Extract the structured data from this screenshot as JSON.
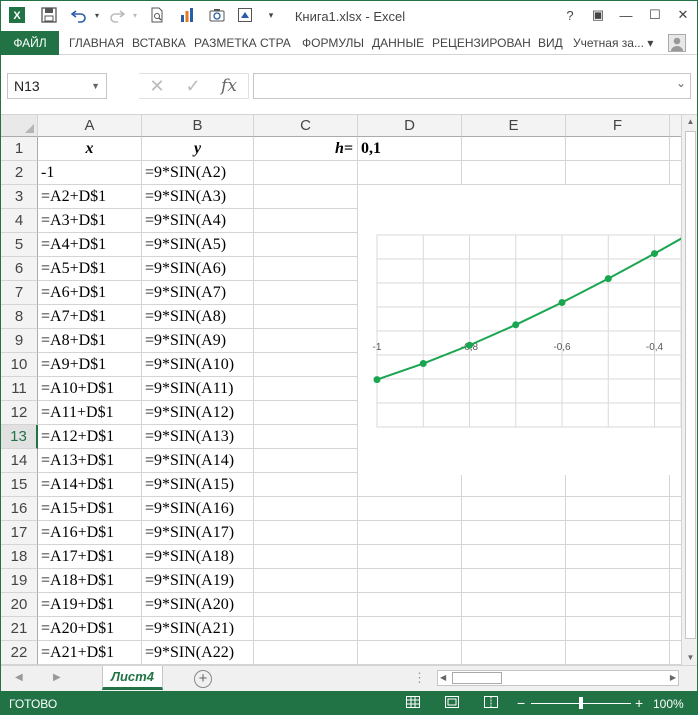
{
  "titlebar": {
    "title": "Книга1.xlsx - Excel",
    "app_icon": "excel-logo",
    "qat_icons": [
      "save-icon",
      "undo-icon",
      "redo-icon",
      "print-preview-icon",
      "chart-icon",
      "camera-icon",
      "screenshot-icon",
      "customize-qat-icon"
    ],
    "help": "?",
    "ribbon_display": "▣",
    "minimize": "—",
    "maximize": "☐",
    "close": "✕"
  },
  "ribbon": {
    "file_tab": "ФАЙЛ",
    "tabs": [
      "ГЛАВНАЯ",
      "ВСТАВКА",
      "РАЗМЕТКА СТРА",
      "ФОРМУЛЫ",
      "ДАННЫЕ",
      "РЕЦЕНЗИРОВАН",
      "ВИД"
    ],
    "account": "Учетная за...",
    "account_arrow": "▾"
  },
  "formula_bar": {
    "name_box": "N13",
    "cancel_glyph": "✕",
    "enter_glyph": "✓",
    "fx_label": "fx",
    "formula": ""
  },
  "grid": {
    "column_headers": [
      "A",
      "B",
      "C",
      "D",
      "E",
      "F"
    ],
    "row_headers": [
      "1",
      "2",
      "3",
      "4",
      "5",
      "6",
      "7",
      "8",
      "9",
      "10",
      "11",
      "12",
      "13",
      "14",
      "15",
      "16",
      "17",
      "18",
      "19",
      "20",
      "21",
      "22"
    ],
    "selected_row": "13",
    "header_row": {
      "A": "x",
      "B": "y",
      "C": "h=",
      "D": "0,1"
    },
    "col_a": [
      "-1",
      "=A2+D$1",
      "=A3+D$1",
      "=A4+D$1",
      "=A5+D$1",
      "=A6+D$1",
      "=A7+D$1",
      "=A8+D$1",
      "=A9+D$1",
      "=A10+D$1",
      "=A11+D$1",
      "=A12+D$1",
      "=A13+D$1",
      "=A14+D$1",
      "=A15+D$1",
      "=A16+D$1",
      "=A17+D$1",
      "=A18+D$1",
      "=A19+D$1",
      "=A20+D$1",
      "=A21+D$1"
    ],
    "col_b": [
      "=9*SIN(A2)",
      "=9*SIN(A3)",
      "=9*SIN(A4)",
      "=9*SIN(A5)",
      "=9*SIN(A6)",
      "=9*SIN(A7)",
      "=9*SIN(A8)",
      "=9*SIN(A9)",
      "=9*SIN(A10)",
      "=9*SIN(A11)",
      "=9*SIN(A12)",
      "=9*SIN(A13)",
      "=9*SIN(A14)",
      "=9*SIN(A15)",
      "=9*SIN(A16)",
      "=9*SIN(A17)",
      "=9*SIN(A18)",
      "=9*SIN(A19)",
      "=9*SIN(A20)",
      "=9*SIN(A21)",
      "=9*SIN(A22)"
    ]
  },
  "chart": {
    "x_tick_labels": [
      "-1",
      "-0,8",
      "-0,6",
      "-0,4"
    ],
    "line_color": "#1aa550",
    "gridline_color": "#d9d9d9"
  },
  "chart_data": {
    "type": "scatter",
    "x": [
      -1.0,
      -0.9,
      -0.8,
      -0.7,
      -0.6,
      -0.5,
      -0.4,
      -0.3
    ],
    "y": [
      -7.57,
      -7.05,
      -6.46,
      -5.8,
      -5.08,
      -4.31,
      -3.5,
      -2.66
    ],
    "x_range": [
      -1.0,
      -0.3
    ],
    "xlabel": "",
    "ylabel": "",
    "grid": true,
    "markers": true,
    "line": true
  },
  "sheet_tabs": {
    "active": "Лист4",
    "add_glyph": "+",
    "nav_prev": "◀",
    "nav_next": "▶"
  },
  "statusbar": {
    "ready": "ГОТОВО",
    "zoom_minus": "−",
    "zoom_plus": "+",
    "zoom": "100%",
    "zoom_percent": 100
  },
  "colors": {
    "accent": "#217346",
    "series": "#1aa550"
  }
}
